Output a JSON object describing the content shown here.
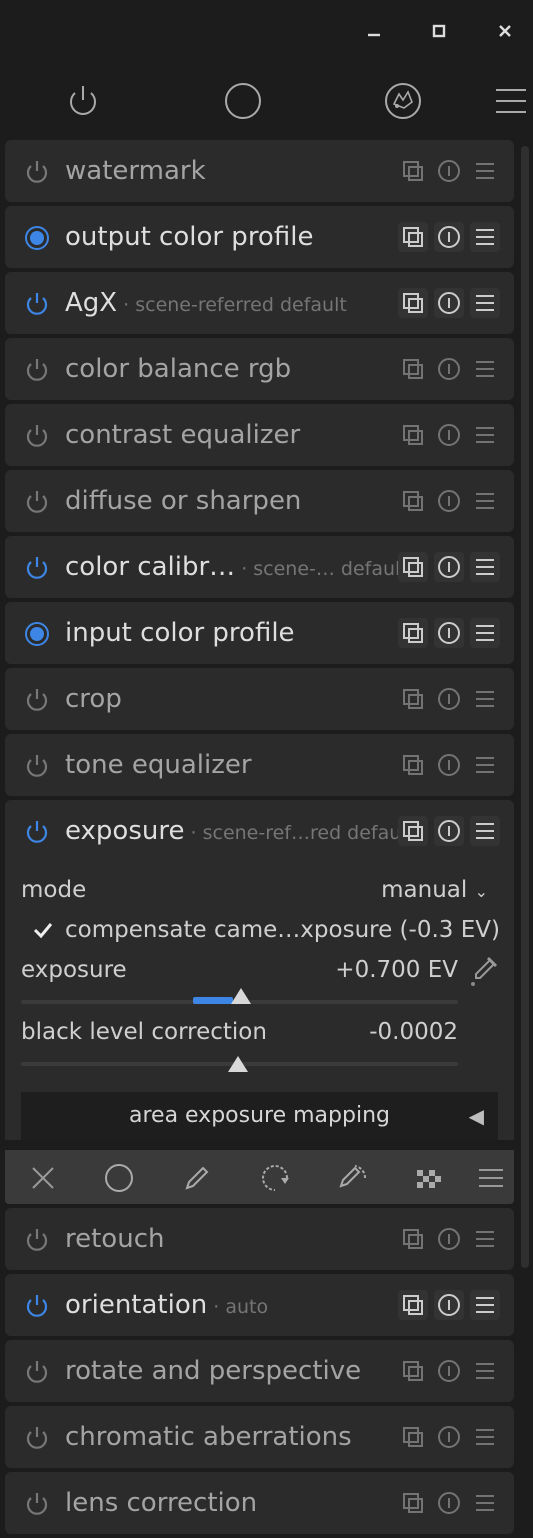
{
  "window_controls": {
    "minimize_icon": "minimize-icon",
    "maximize_icon": "maximize-icon",
    "close_icon": "close-icon"
  },
  "top_icons": [
    "power-icon",
    "circle-icon",
    "presets-icon",
    "menu-icon"
  ],
  "modules_top": [
    {
      "name": "watermark",
      "subtitle": "",
      "state": "off"
    },
    {
      "name": "output color profile",
      "subtitle": "",
      "state": "always-on"
    },
    {
      "name": "AgX",
      "subtitle": " · scene-referred default",
      "state": "on"
    },
    {
      "name": "color balance rgb",
      "subtitle": "",
      "state": "off"
    },
    {
      "name": "contrast equalizer",
      "subtitle": "",
      "state": "off"
    },
    {
      "name": "diffuse or sharpen",
      "subtitle": "",
      "state": "off"
    },
    {
      "name": "color calibr…",
      "subtitle": " · scene-… default",
      "state": "on"
    },
    {
      "name": "input color profile",
      "subtitle": "",
      "state": "always-on"
    },
    {
      "name": "crop",
      "subtitle": "",
      "state": "off"
    },
    {
      "name": "tone equalizer",
      "subtitle": "",
      "state": "off"
    }
  ],
  "exposure_module": {
    "name": "exposure",
    "subtitle": " · scene-ref…red default",
    "mode_label": "mode",
    "mode_value": "manual",
    "compensate_label": "compensate came…xposure (-0.3 EV)",
    "compensate_checked": true,
    "exposure_label": "exposure",
    "exposure_value": "+0.700 EV",
    "exposure_fraction": 0.53,
    "black_label": "black level correction",
    "black_value": "-0.0002",
    "black_fraction": 0.5,
    "area_button": "area exposure mapping",
    "area_arrow": "◀"
  },
  "mask_tools": [
    "close-x-icon",
    "circle-mask-icon",
    "pencil-icon",
    "drawn-parametric-icon",
    "drawn-parametric-brush-icon",
    "raster-mask-icon",
    "menu-icon"
  ],
  "modules_bottom": [
    {
      "name": "retouch",
      "subtitle": "",
      "state": "off"
    },
    {
      "name": "orientation",
      "subtitle": " · auto",
      "state": "on"
    },
    {
      "name": "rotate and perspective",
      "subtitle": "",
      "state": "off"
    },
    {
      "name": "chromatic aberrations",
      "subtitle": "",
      "state": "off"
    },
    {
      "name": "lens correction",
      "subtitle": "",
      "state": "off"
    }
  ],
  "colors": {
    "accent": "#3d86e6",
    "panel": "#2b2b2b",
    "background": "#1c1c1c"
  }
}
